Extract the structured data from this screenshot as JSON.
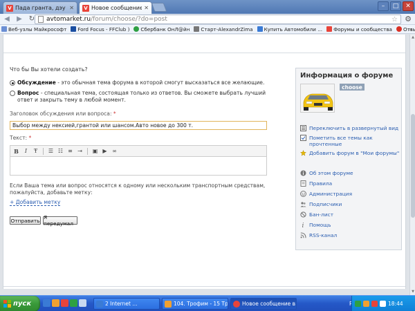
{
  "browser": {
    "tabs": [
      {
        "title": "Пада гранта, дэу нексия и",
        "favicon": "V",
        "active": false
      },
      {
        "title": "Новое сообщение в форум",
        "favicon": "V",
        "active": true
      }
    ],
    "window_controls": {
      "minimize": "–",
      "maximize": "□",
      "close": "✕"
    },
    "address": {
      "host": "avtomarket.ru",
      "path": "/forum/choose/?do=post"
    },
    "bookmarks": [
      {
        "label": "Веб-узлы Майкрософт",
        "color": "#6b8fd4"
      },
      {
        "label": "Ford Focus - FFClub )",
        "color": "#1a4ea1"
      },
      {
        "label": "Сбербанк ОнЛ@йн",
        "color": "#2ea043"
      },
      {
        "label": "Старт-AlexandrZima",
        "color": "#777777"
      },
      {
        "label": "Купить Автомобили ...",
        "color": "#3a7bd5"
      },
      {
        "label": "Форумы и сообщества",
        "color": "#e8443a"
      },
      {
        "label": "Отзывы автовладел...",
        "color": "#d93025"
      }
    ],
    "bookmarks_more": "»"
  },
  "form": {
    "question": "Что бы Вы хотели создать?",
    "option_discussion": {
      "bold": "Обсуждение",
      "rest": " - это обычная тема форума в которой смогут высказаться все желающие.",
      "checked": true
    },
    "option_question": {
      "bold": "Вопрос",
      "rest": " - специальная тема, состоящая только из ответов. Вы сможете выбрать лучший ответ и закрыть тему в любой момент.",
      "checked": false
    },
    "title_label": "Заголовок обсуждения или вопроса:",
    "required_mark": "*",
    "title_value": "Выбор между нексией,грантой или шансом.Авто новое до 300 т.",
    "text_label": "Текст:",
    "toolbar": {
      "bold": "B",
      "italic": "I",
      "strike": "Ŧ",
      "list_ul": "☰",
      "list_ol": "☷",
      "align": "≡",
      "indent": "⇥",
      "image": "▣",
      "video": "▶",
      "link": "∞"
    },
    "hint": "Если Ваша тема или вопрос относятся к одному или нескольким транспортным средствам, пожалуйста, добавьте метку:",
    "add_tag": "+ Добавить метку",
    "submit": "Отправить",
    "cancel": "Я передумал"
  },
  "sidebar": {
    "title": "Информация о форуме",
    "forum_name": "choose",
    "actions": [
      {
        "label": "Переключить в развернутый вид",
        "icon": "expand-icon"
      },
      {
        "label": "Пометить все темы как прочтенные",
        "icon": "mark-read-icon"
      },
      {
        "label": "Добавить форум в \"Мои форумы\"",
        "icon": "add-star-icon"
      }
    ],
    "links": [
      {
        "label": "Об этом форуме",
        "icon": "info-icon"
      },
      {
        "label": "Правила",
        "icon": "rules-icon"
      },
      {
        "label": "Администрация",
        "icon": "admin-icon"
      },
      {
        "label": "Подписчики",
        "icon": "subscribers-icon"
      },
      {
        "label": "Бан-лист",
        "icon": "ban-icon"
      },
      {
        "label": "Помощь",
        "icon": "help-icon"
      },
      {
        "label": "RSS-канал",
        "icon": "rss-icon"
      }
    ]
  },
  "taskbar": {
    "start": "пуск",
    "tasks": [
      {
        "label": "2 Internet ...",
        "color": "#3a7bd5",
        "active": false
      },
      {
        "label": "104. Трофим - 15 Тр...",
        "color": "#f0a030",
        "active": false
      },
      {
        "label": "Новое сообщение в ...",
        "color": "#e8443a",
        "active": true
      }
    ],
    "lang": "RL",
    "clock": "18:44"
  },
  "colors": {
    "link": "#2a5db0",
    "accent": "#e0b45a",
    "taskbar": "#2558c7",
    "start": "#3a9a3a"
  }
}
